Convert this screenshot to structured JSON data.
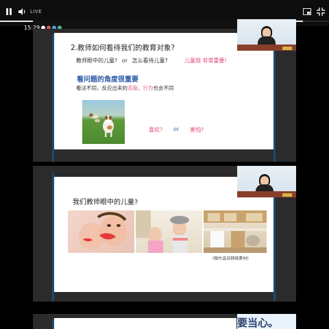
{
  "player": {
    "live_label": "LIVE",
    "progress": 0.92
  },
  "status": {
    "time": "15:29"
  },
  "slide1": {
    "title": "2.教师如何看待我们的教育对象?",
    "line1_a": "教师眼中的儿童?",
    "line1_or": "or",
    "line1_b": "怎么看待儿童?",
    "line1_note": "儿童观  非常重要!",
    "heading": "看问题的角度很重要",
    "sub_a": "看法不同，反应出来的",
    "sub_b": "态度",
    "sub_c": "、",
    "sub_d": "行为",
    "sub_e": "也会不同",
    "q_like": "喜欢？",
    "q_or": "or",
    "q_fear": "害怕?"
  },
  "slide2": {
    "title": "我们教师眼中的儿童?",
    "caption": "(图片选自网络素材)"
  },
  "slide3": {
    "text": "要当心。"
  },
  "colors": {
    "accent_blue": "#24587c",
    "pink": "#e0457b",
    "desk": "#8a3f2c"
  }
}
